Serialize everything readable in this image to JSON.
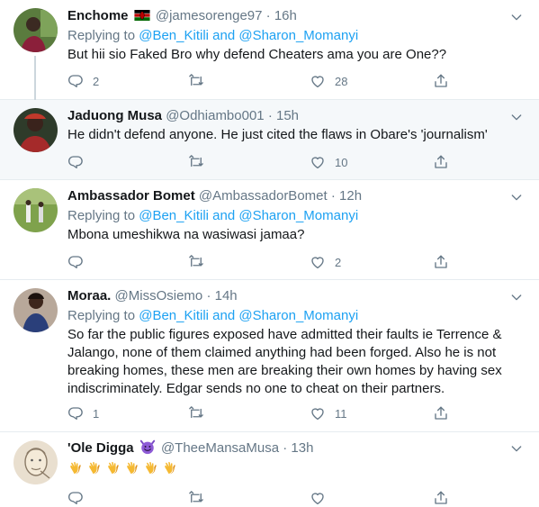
{
  "tweets": [
    {
      "name": "Enchome",
      "flag": "kenya-flag",
      "handle": "@jamesorenge97",
      "sep": "·",
      "time": "16h",
      "replying_prefix": "Replying to",
      "mention1": "@Ben_Kitili",
      "and": "and",
      "mention2": "@Sharon_Momanyi",
      "text": "But hii sio Faked Bro why defend Cheaters ama you are One??",
      "replies": "2",
      "retweets": "",
      "likes": "28"
    },
    {
      "name": "Jaduong Musa",
      "handle": "@Odhiambo001",
      "sep": "·",
      "time": "15h",
      "text": "He didn't defend anyone. He just cited the flaws in Obare's 'journalism'",
      "replies": "",
      "retweets": "",
      "likes": "10"
    },
    {
      "name": "Ambassador Bomet",
      "handle": "@AmbassadorBomet",
      "sep": "·",
      "time": "12h",
      "replying_prefix": "Replying to",
      "mention1": "@Ben_Kitili",
      "and": "and",
      "mention2": "@Sharon_Momanyi",
      "text": "Mbona umeshikwa na wasiwasi jamaa?",
      "replies": "",
      "retweets": "",
      "likes": "2"
    },
    {
      "name": "Moraa.",
      "handle": "@MissOsiemo",
      "sep": "·",
      "time": "14h",
      "replying_prefix": "Replying to",
      "mention1": "@Ben_Kitili",
      "and": "and",
      "mention2": "@Sharon_Momanyi",
      "text_lines": [
        "So far the public figures exposed have admitted their faults ie Terrence &",
        "Jalango, none of them claimed anything had been forged. Also he is not",
        "breaking homes, these men are breaking their own homes by having sex",
        "indiscriminately. Edgar sends no one to cheat on their partners."
      ],
      "replies": "1",
      "retweets": "",
      "likes": "11"
    },
    {
      "name": "'Ole Digga",
      "name_emoji": "smiling-devil-emoji",
      "handle": "@TheeMansaMusa",
      "sep": "·",
      "time": "13h",
      "text_emoji": "clapping-hands-emoji x6"
    }
  ],
  "colors": {
    "accent": "#1da1f2",
    "muted": "#657786",
    "divider": "#e6ecf0",
    "highlight": "#f5f8fa"
  }
}
